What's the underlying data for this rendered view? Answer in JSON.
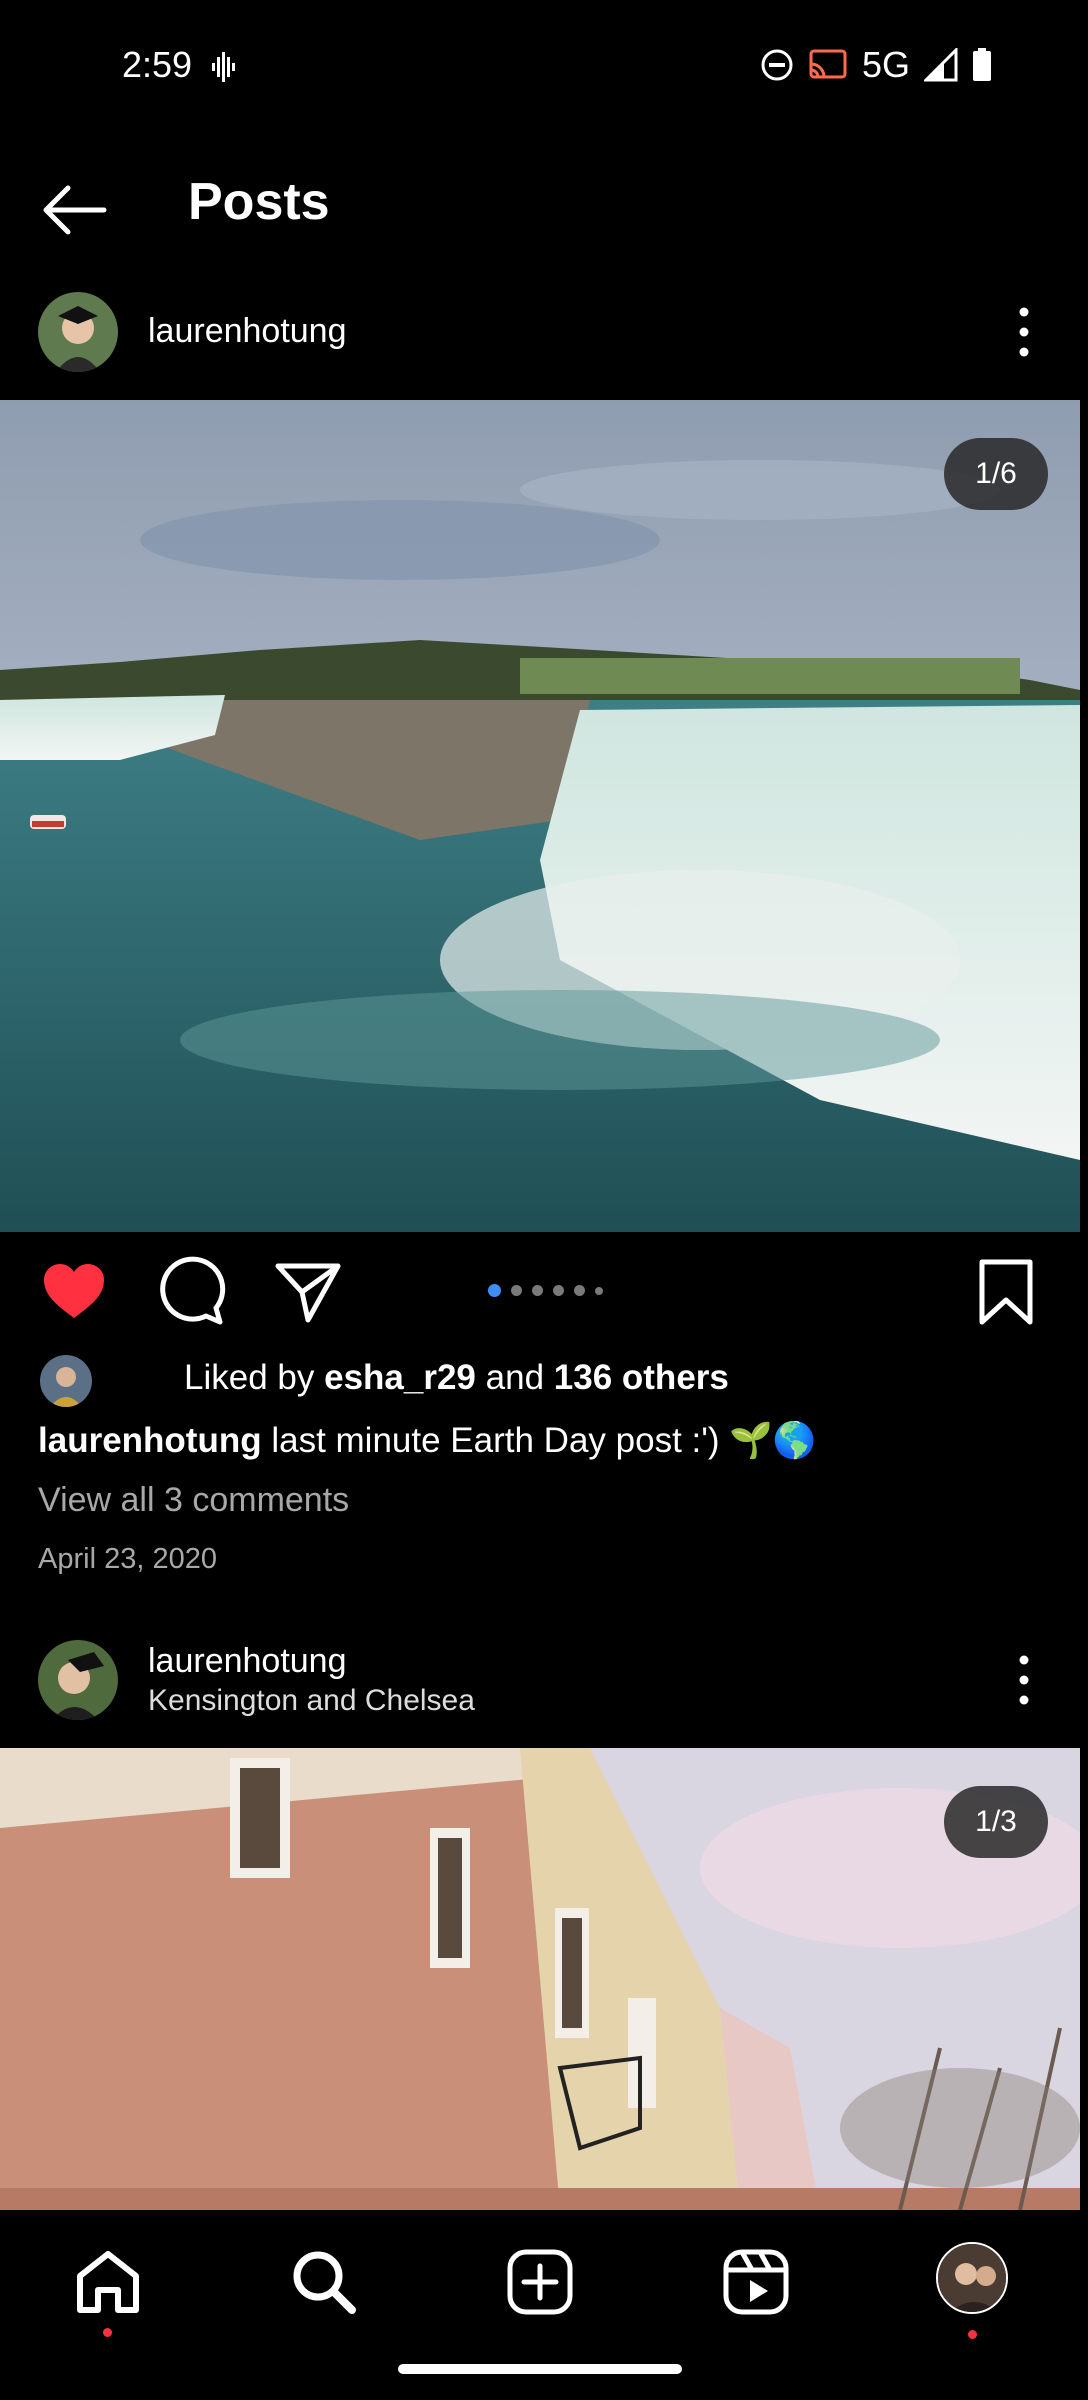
{
  "status_bar": {
    "time": "2:59",
    "network": "5G"
  },
  "header": {
    "title": "Posts"
  },
  "post1": {
    "username": "laurenhotung",
    "image_counter": "1/6",
    "carousel": {
      "total": 6,
      "active_index": 0
    },
    "liked_prefix": "Liked by",
    "liked_user": "esha_r29",
    "liked_and": "and",
    "liked_others": "136 others",
    "caption_user": "laurenhotung",
    "caption_text": "last minute Earth Day post :') 🌱🌎",
    "view_comments": "View all 3 comments",
    "date": "April 23, 2020"
  },
  "post2": {
    "username": "laurenhotung",
    "location": "Kensington and Chelsea",
    "image_counter": "1/3"
  },
  "icons": {
    "back": "back-arrow-icon",
    "more": "more-vert-icon",
    "like": "heart-icon",
    "comment": "comment-icon",
    "share": "send-icon",
    "save": "bookmark-icon",
    "home": "home-icon",
    "search": "search-icon",
    "create": "add-post-icon",
    "reels": "reels-icon"
  },
  "colors": {
    "like_red": "#ff3040",
    "dot_blue": "#3f8ef7",
    "muted": "#a8a8a8"
  }
}
